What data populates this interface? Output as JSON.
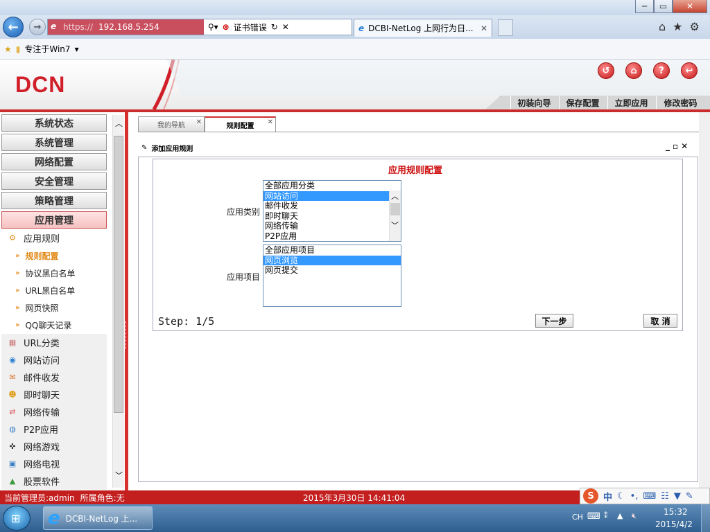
{
  "browser": {
    "address": {
      "protocol": "https://",
      "host": "192.168.5.254",
      "cert_error": "证书错误"
    },
    "tab_title": "DCBI-NetLog 上网行为日...",
    "favorites_item": "专注于Win7"
  },
  "header": {
    "logo": "DCN",
    "buttons": [
      "初装向导",
      "保存配置",
      "立即应用",
      "修改密码"
    ]
  },
  "sidebar": {
    "main_items": [
      "系统状态",
      "系统管理",
      "网络配置",
      "安全管理",
      "策略管理",
      "应用管理"
    ],
    "active_main": "应用管理",
    "sub_group": "应用规则",
    "leaves": [
      "规则配置",
      "协议黑白名单",
      "URL黑白名单",
      "网页快照",
      "QQ聊天记录"
    ],
    "active_leaf": "规则配置",
    "categories": [
      "URL分类",
      "网站访问",
      "邮件收发",
      "即时聊天",
      "网络传输",
      "P2P应用",
      "网络游戏",
      "网络电视",
      "股票软件"
    ]
  },
  "tabs": [
    "我的导航",
    "规则配置"
  ],
  "panel": {
    "title": "添加应用规则",
    "form_title": "应用规则配置",
    "category_label": "应用类别",
    "category_options": [
      "全部应用分类",
      "网站访问",
      "邮件收发",
      "即时聊天",
      "网络传输",
      "P2P应用"
    ],
    "category_selected": "网站访问",
    "item_label": "应用项目",
    "item_options": [
      "全部应用项目",
      "网页浏览",
      "网页提交"
    ],
    "item_selected": "网页浏览",
    "step": "Step: 1/5",
    "next_button": "下一步",
    "cancel_button": "取 消"
  },
  "status": {
    "admin": "当前管理员:admin",
    "role": "所属角色:无",
    "datetime": "2015年3月30日 14:41:04"
  },
  "taskbar": {
    "task_label": "DCBI-NetLog 上...",
    "lang": "CH",
    "ime": "中",
    "time": "15:32",
    "date": "2015/4/2"
  },
  "colors": {
    "brand_red": "#cc2b2b",
    "selection_blue": "#3399ff"
  }
}
